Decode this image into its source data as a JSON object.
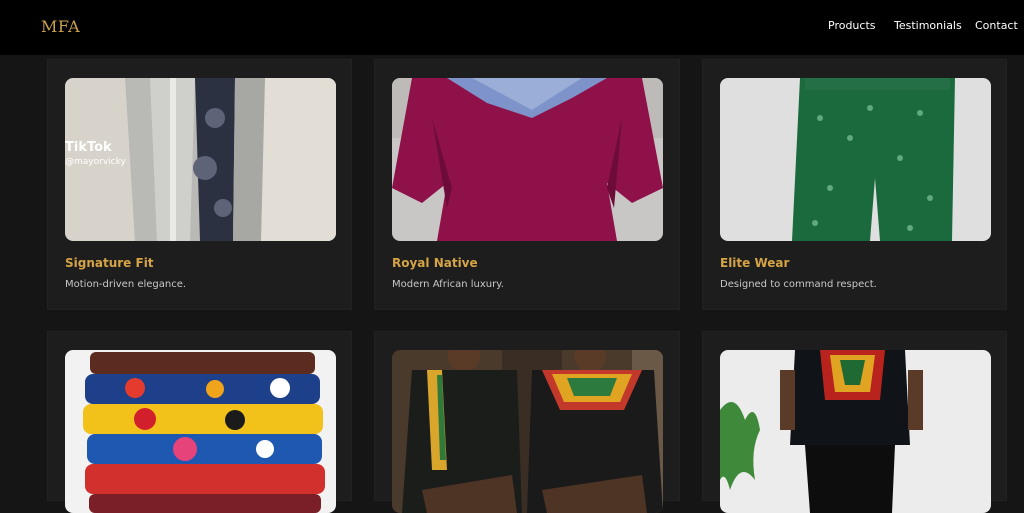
{
  "nav": {
    "logo": "MFA",
    "links": [
      "Products",
      "Testimonials",
      "Contact"
    ]
  },
  "products": [
    {
      "title": "Signature Fit",
      "description": "Motion-driven elegance.",
      "watermark": {
        "brand": "TikTok",
        "handle": "@mayorvicky"
      }
    },
    {
      "title": "Royal Native",
      "description": "Modern African luxury."
    },
    {
      "title": "Elite Wear",
      "description": "Designed to command respect."
    },
    {
      "title": "",
      "description": ""
    },
    {
      "title": "",
      "description": ""
    },
    {
      "title": "",
      "description": ""
    }
  ],
  "colors": {
    "page_background": "#151515",
    "navbar_background": "#000000",
    "card_background": "#1d1d1d",
    "accent_gold": "#d5a445",
    "logo_gold": "#c9a24a"
  }
}
